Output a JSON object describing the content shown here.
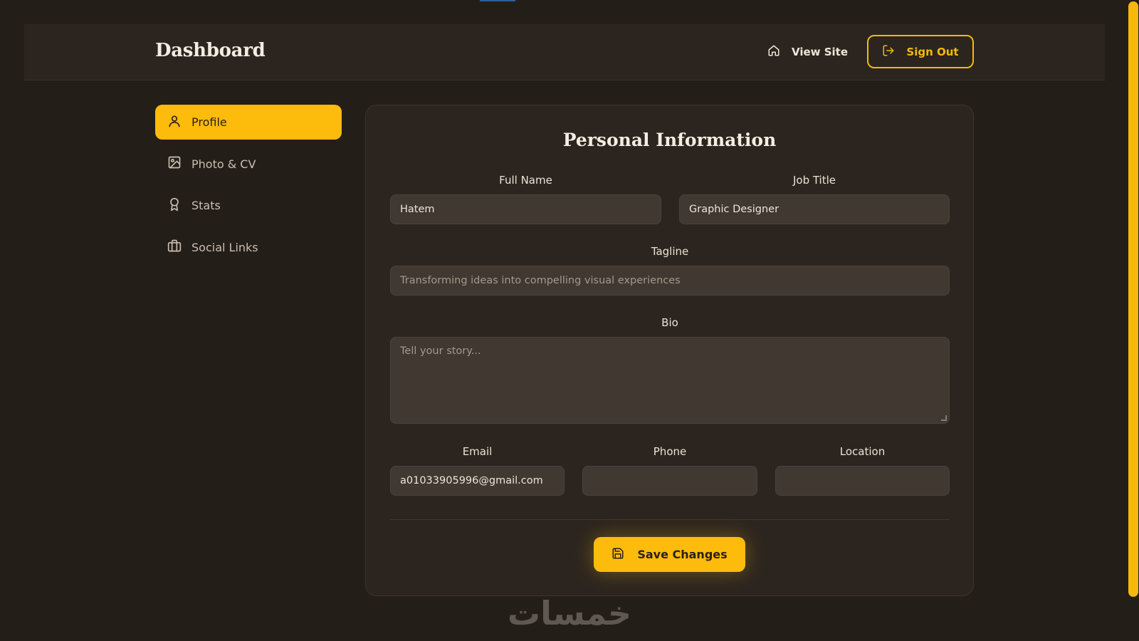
{
  "header": {
    "brand": "Dashboard",
    "view_site_label": "View Site",
    "sign_out_label": "Sign Out"
  },
  "sidebar": {
    "items": [
      {
        "label": "Profile",
        "icon": "user-icon",
        "active": true
      },
      {
        "label": "Photo & CV",
        "icon": "image-icon",
        "active": false
      },
      {
        "label": "Stats",
        "icon": "award-icon",
        "active": false
      },
      {
        "label": "Social Links",
        "icon": "briefcase-icon",
        "active": false
      }
    ]
  },
  "form": {
    "title": "Personal Information",
    "full_name": {
      "label": "Full Name",
      "value": "Hatem"
    },
    "job_title": {
      "label": "Job Title",
      "value": "Graphic Designer"
    },
    "tagline": {
      "label": "Tagline",
      "placeholder": "Transforming ideas into compelling visual experiences"
    },
    "bio": {
      "label": "Bio",
      "placeholder": "Tell your story..."
    },
    "email": {
      "label": "Email",
      "value": "a01033905996@gmail.com"
    },
    "phone": {
      "label": "Phone",
      "value": ""
    },
    "location": {
      "label": "Location",
      "value": ""
    },
    "save_label": "Save Changes"
  },
  "watermark": "خمسات",
  "colors": {
    "accent": "#fdbb0b",
    "background": "#241e18",
    "panel": "#2c251f",
    "input": "#403831"
  }
}
